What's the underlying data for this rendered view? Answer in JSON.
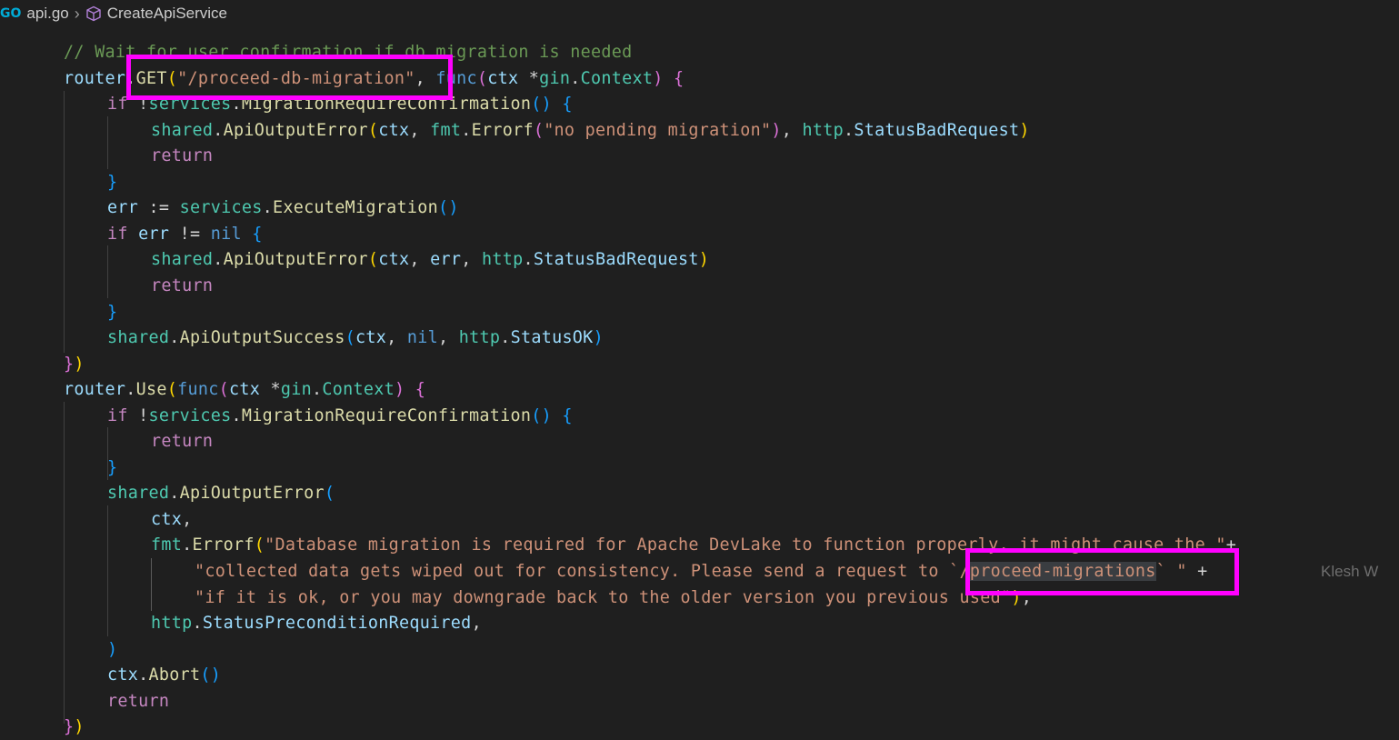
{
  "breadcrumb": {
    "file_label": "api.go",
    "symbol_label": "CreateApiService",
    "file_icon": "go-file-icon",
    "symbol_icon": "method-cube-icon"
  },
  "editor": {
    "ghost_text": "Klesh W",
    "lines": [
      [
        [
          "c-cm",
          "// Wait for user confirmation if db migration is needed"
        ]
      ],
      [
        [
          "c-var",
          "router"
        ],
        [
          "c-op",
          "."
        ],
        [
          "c-fn",
          "GET"
        ],
        [
          "c-b1",
          "("
        ],
        [
          "c-str",
          "\"/proceed-db-migration\""
        ],
        [
          "c-op",
          ", "
        ],
        [
          "c-key",
          "func"
        ],
        [
          "c-b2",
          "("
        ],
        [
          "c-var",
          "ctx "
        ],
        [
          "c-op",
          "*"
        ],
        [
          "c-type",
          "gin"
        ],
        [
          "c-op",
          "."
        ],
        [
          "c-type",
          "Context"
        ],
        [
          "c-b2",
          ")"
        ],
        [
          "c-op",
          " "
        ],
        [
          "c-b2",
          "{"
        ]
      ],
      [
        [
          "c-kw",
          "if "
        ],
        [
          "c-op",
          "!"
        ],
        [
          "c-type",
          "services"
        ],
        [
          "c-op",
          "."
        ],
        [
          "c-fn",
          "MigrationRequireConfirmation"
        ],
        [
          "c-b3",
          "()"
        ],
        [
          "c-op",
          " "
        ],
        [
          "c-b3",
          "{"
        ]
      ],
      [
        [
          "c-type",
          "shared"
        ],
        [
          "c-op",
          "."
        ],
        [
          "c-fn",
          "ApiOutputError"
        ],
        [
          "c-b1",
          "("
        ],
        [
          "c-var",
          "ctx"
        ],
        [
          "c-op",
          ", "
        ],
        [
          "c-type",
          "fmt"
        ],
        [
          "c-op",
          "."
        ],
        [
          "c-fn",
          "Errorf"
        ],
        [
          "c-b2",
          "("
        ],
        [
          "c-str",
          "\"no pending migration\""
        ],
        [
          "c-b2",
          ")"
        ],
        [
          "c-op",
          ", "
        ],
        [
          "c-type",
          "http"
        ],
        [
          "c-op",
          "."
        ],
        [
          "c-var",
          "StatusBadRequest"
        ],
        [
          "c-b1",
          ")"
        ]
      ],
      [
        [
          "c-kw",
          "return"
        ]
      ],
      [
        [
          "c-b3",
          "}"
        ]
      ],
      [
        [
          "c-var",
          "err "
        ],
        [
          "c-op",
          ":= "
        ],
        [
          "c-type",
          "services"
        ],
        [
          "c-op",
          "."
        ],
        [
          "c-fn",
          "ExecuteMigration"
        ],
        [
          "c-b3",
          "()"
        ]
      ],
      [
        [
          "c-kw",
          "if "
        ],
        [
          "c-var",
          "err "
        ],
        [
          "c-op",
          "!= "
        ],
        [
          "c-key",
          "nil "
        ],
        [
          "c-b3",
          "{"
        ]
      ],
      [
        [
          "c-type",
          "shared"
        ],
        [
          "c-op",
          "."
        ],
        [
          "c-fn",
          "ApiOutputError"
        ],
        [
          "c-b1",
          "("
        ],
        [
          "c-var",
          "ctx"
        ],
        [
          "c-op",
          ", "
        ],
        [
          "c-var",
          "err"
        ],
        [
          "c-op",
          ", "
        ],
        [
          "c-type",
          "http"
        ],
        [
          "c-op",
          "."
        ],
        [
          "c-var",
          "StatusBadRequest"
        ],
        [
          "c-b1",
          ")"
        ]
      ],
      [
        [
          "c-kw",
          "return"
        ]
      ],
      [
        [
          "c-b3",
          "}"
        ]
      ],
      [
        [
          "c-type",
          "shared"
        ],
        [
          "c-op",
          "."
        ],
        [
          "c-fn",
          "ApiOutputSuccess"
        ],
        [
          "c-b3",
          "("
        ],
        [
          "c-var",
          "ctx"
        ],
        [
          "c-op",
          ", "
        ],
        [
          "c-key",
          "nil"
        ],
        [
          "c-op",
          ", "
        ],
        [
          "c-type",
          "http"
        ],
        [
          "c-op",
          "."
        ],
        [
          "c-var",
          "StatusOK"
        ],
        [
          "c-b3",
          ")"
        ]
      ],
      [
        [
          "c-b2",
          "}"
        ],
        [
          "c-b1",
          ")"
        ]
      ],
      [
        [
          "c-var",
          "router"
        ],
        [
          "c-op",
          "."
        ],
        [
          "c-fn",
          "Use"
        ],
        [
          "c-b1",
          "("
        ],
        [
          "c-key",
          "func"
        ],
        [
          "c-b2",
          "("
        ],
        [
          "c-var",
          "ctx "
        ],
        [
          "c-op",
          "*"
        ],
        [
          "c-type",
          "gin"
        ],
        [
          "c-op",
          "."
        ],
        [
          "c-type",
          "Context"
        ],
        [
          "c-b2",
          ")"
        ],
        [
          "c-op",
          " "
        ],
        [
          "c-b2",
          "{"
        ]
      ],
      [
        [
          "c-kw",
          "if "
        ],
        [
          "c-op",
          "!"
        ],
        [
          "c-type",
          "services"
        ],
        [
          "c-op",
          "."
        ],
        [
          "c-fn",
          "MigrationRequireConfirmation"
        ],
        [
          "c-b3",
          "()"
        ],
        [
          "c-op",
          " "
        ],
        [
          "c-b3",
          "{"
        ]
      ],
      [
        [
          "c-kw",
          "return"
        ]
      ],
      [
        [
          "c-b3",
          "}"
        ]
      ],
      [
        [
          "c-type",
          "shared"
        ],
        [
          "c-op",
          "."
        ],
        [
          "c-fn",
          "ApiOutputError"
        ],
        [
          "c-b3",
          "("
        ]
      ],
      [
        [
          "c-var",
          "ctx"
        ],
        [
          "c-op",
          ","
        ]
      ],
      [
        [
          "c-type",
          "fmt"
        ],
        [
          "c-op",
          "."
        ],
        [
          "c-fn",
          "Errorf"
        ],
        [
          "c-b1",
          "("
        ],
        [
          "c-str",
          "\"Database migration is required for Apache DevLake to function properly, it might cause the \""
        ],
        [
          "c-op",
          "+"
        ]
      ],
      [
        [
          "c-str",
          "\"collected data gets wiped out for consistency. Please send a request to `/"
        ],
        [
          "sel c-str",
          "proceed-migrations"
        ],
        [
          "c-str",
          "` \""
        ],
        [
          "c-op",
          " +"
        ]
      ],
      [
        [
          "c-str",
          "\"if it is ok, or you may downgrade back to the older version you previous used\""
        ],
        [
          "c-b1",
          ")"
        ],
        [
          "c-op",
          ","
        ]
      ],
      [
        [
          "c-type",
          "http"
        ],
        [
          "c-op",
          "."
        ],
        [
          "c-var",
          "StatusPreconditionRequired"
        ],
        [
          "c-op",
          ","
        ]
      ],
      [
        [
          "c-b3",
          ")"
        ]
      ],
      [
        [
          "c-var",
          "ctx"
        ],
        [
          "c-op",
          "."
        ],
        [
          "c-fn",
          "Abort"
        ],
        [
          "c-b3",
          "()"
        ]
      ],
      [
        [
          "c-kw",
          "return"
        ]
      ],
      [
        [
          "c-b2",
          "}"
        ],
        [
          "c-b1",
          ")"
        ]
      ]
    ]
  }
}
